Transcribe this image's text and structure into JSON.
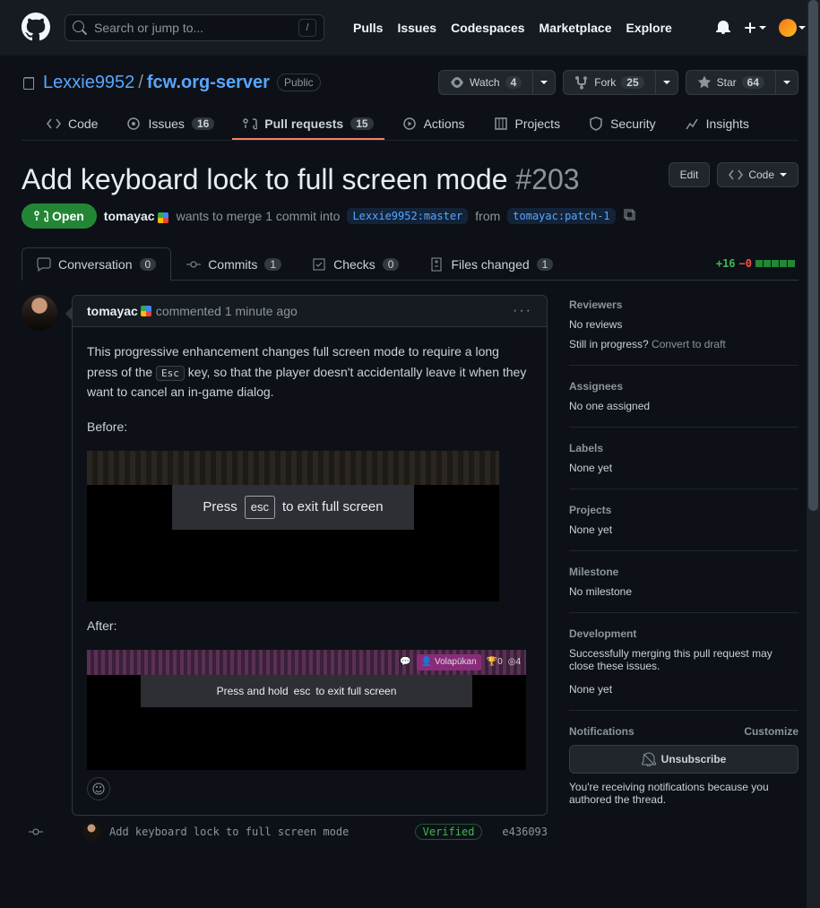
{
  "topnav": {
    "search_placeholder": "Search or jump to...",
    "slash": "/",
    "links": [
      "Pulls",
      "Issues",
      "Codespaces",
      "Marketplace",
      "Explore"
    ]
  },
  "repo": {
    "owner": "Lexxie9952",
    "sep": "/",
    "name": "fcw.org-server",
    "visibility": "Public",
    "watch": {
      "label": "Watch",
      "count": "4"
    },
    "fork": {
      "label": "Fork",
      "count": "25"
    },
    "star": {
      "label": "Star",
      "count": "64"
    }
  },
  "tabs": {
    "code": "Code",
    "issues": "Issues",
    "issues_count": "16",
    "pulls": "Pull requests",
    "pulls_count": "15",
    "actions": "Actions",
    "projects": "Projects",
    "security": "Security",
    "insights": "Insights"
  },
  "pr": {
    "title": "Add keyboard lock to full screen mode",
    "number": "#203",
    "edit": "Edit",
    "code_btn": "Code",
    "state": "Open",
    "author": "tomayac",
    "wants": "wants to merge 1 commit into",
    "base": "Lexxie9952:master",
    "from": "from",
    "head": "tomayac:patch-1"
  },
  "convtabs": {
    "conversation": "Conversation",
    "conversation_n": "0",
    "commits": "Commits",
    "commits_n": "1",
    "checks": "Checks",
    "checks_n": "0",
    "files": "Files changed",
    "files_n": "1",
    "add": "+16",
    "del": "−0"
  },
  "comment": {
    "author": "tomayac",
    "when": "commented 1 minute ago",
    "p1a": "This progressive enhancement changes full screen mode to require a long press of the ",
    "p1kbd": "Esc",
    "p1b": " key, so that the player doesn't accidentally leave it when they want to cancel an in-game dialog.",
    "before": "Before:",
    "after": "After:",
    "shot1_press": "Press",
    "shot1_esc": "esc",
    "shot1_exit": "to exit full screen",
    "shot2_hold": "Press and hold",
    "shot2_esc": "esc",
    "shot2_exit": "to exit full screen",
    "volap": "Volapükan",
    "trophy": "0",
    "target": "4"
  },
  "commit": {
    "msg": "Add keyboard lock to full screen mode",
    "verified": "Verified",
    "sha": "e436093"
  },
  "sidebar": {
    "reviewers": "Reviewers",
    "no_reviews": "No reviews",
    "still": "Still in progress? ",
    "convert": "Convert to draft",
    "assignees": "Assignees",
    "no_one": "No one assigned",
    "labels": "Labels",
    "labels_none": "None yet",
    "projects": "Projects",
    "projects_none": "None yet",
    "milestone": "Milestone",
    "milestone_none": "No milestone",
    "development": "Development",
    "dev_text": "Successfully merging this pull request may close these issues.",
    "dev_none": "None yet",
    "notifications": "Notifications",
    "customize": "Customize",
    "unsubscribe": "Unsubscribe",
    "notif_reason": "You're receiving notifications because you authored the thread."
  }
}
